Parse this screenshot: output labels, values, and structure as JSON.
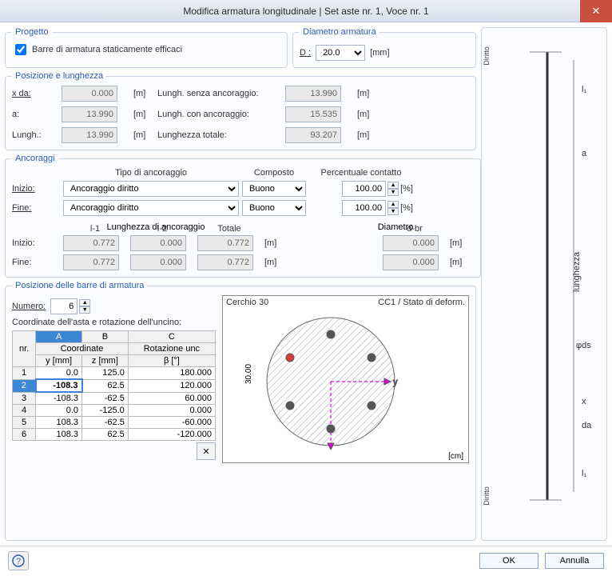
{
  "title": "Modifica armatura longitudinale | Set aste nr. 1, Voce nr. 1",
  "project": {
    "legend": "Progetto",
    "checkbox_label": "Barre di armatura staticamente efficaci",
    "checked": true
  },
  "diameter": {
    "legend": "Diametro armatura",
    "label": "D :",
    "value": "20.0",
    "unit": "[mm]"
  },
  "position": {
    "legend": "Posizione e lunghezza",
    "x_from_label": "x da:",
    "x_from": "0.000",
    "a_label": "a:",
    "a": "13.990",
    "lungh_label": "Lungh.:",
    "lungh": "13.990",
    "l_no_anchor_label": "Lungh. senza ancoraggio:",
    "l_no_anchor": "13.990",
    "l_with_anchor_label": "Lungh. con ancoraggio:",
    "l_with_anchor": "15.535",
    "l_total_label": "Lunghezza totale:",
    "l_total": "93.207",
    "unit": "[m]"
  },
  "anchorages": {
    "legend": "Ancoraggi",
    "hdr_type": "Tipo di ancoraggio",
    "hdr_comp": "Composto",
    "hdr_pct": "Percentuale contatto",
    "start_label": "Inizio:",
    "end_label": "Fine:",
    "type_value": "Ancoraggio diritto",
    "comp_value": "Buono",
    "pct_value": "100.00",
    "pct_unit": "[%]",
    "len_group_label": "Lunghezza di ancoraggio",
    "l1_label": "l-1",
    "l2_label": "l-2",
    "total_label": "Totale",
    "diam_group_label": "Diametro",
    "dbr_label": "d-br",
    "start_l1": "0.772",
    "start_l2": "0.000",
    "start_tot": "0.772",
    "start_dbr": "0.000",
    "end_l1": "0.772",
    "end_l2": "0.000",
    "end_tot": "0.772",
    "end_dbr": "0.000",
    "unit": "[m]"
  },
  "bars": {
    "legend": "Posizione delle barre di armatura",
    "num_label": "Numero:",
    "num_value": "6",
    "coord_label": "Coordinate dell'asta e rotazione dell'uncino:",
    "colA": "A",
    "colB": "B",
    "colC": "C",
    "coord_hdr": "Coordinate",
    "rot_hdr": "Rotazione unc",
    "y_hdr": "y [mm]",
    "z_hdr": "z [mm]",
    "beta_hdr": "β [°]",
    "rows": [
      {
        "nr": "1",
        "y": "0.0",
        "z": "125.0",
        "b": "180.000"
      },
      {
        "nr": "2",
        "y": "-108.3",
        "z": "62.5",
        "b": "120.000"
      },
      {
        "nr": "3",
        "y": "-108.3",
        "z": "-62.5",
        "b": "60.000"
      },
      {
        "nr": "4",
        "y": "0.0",
        "z": "-125.0",
        "b": "0.000"
      },
      {
        "nr": "5",
        "y": "108.3",
        "z": "-62.5",
        "b": "-60.000"
      },
      {
        "nr": "6",
        "y": "108.3",
        "z": "62.5",
        "b": "-120.000"
      }
    ],
    "preview_title": "Cerchio 30",
    "preview_state": "CC1 / Stato di deform.",
    "dim": "30.00",
    "cm": "[cm]"
  },
  "side": {
    "diritto_top": "Diritto",
    "diritto_bot": "Diritto",
    "lunghezza": "lunghezza",
    "a": "a",
    "da": "da",
    "x": "x",
    "phi": "φds",
    "l1t": "l₁",
    "l1b": "l₁"
  },
  "buttons": {
    "ok": "OK",
    "cancel": "Annulla"
  }
}
